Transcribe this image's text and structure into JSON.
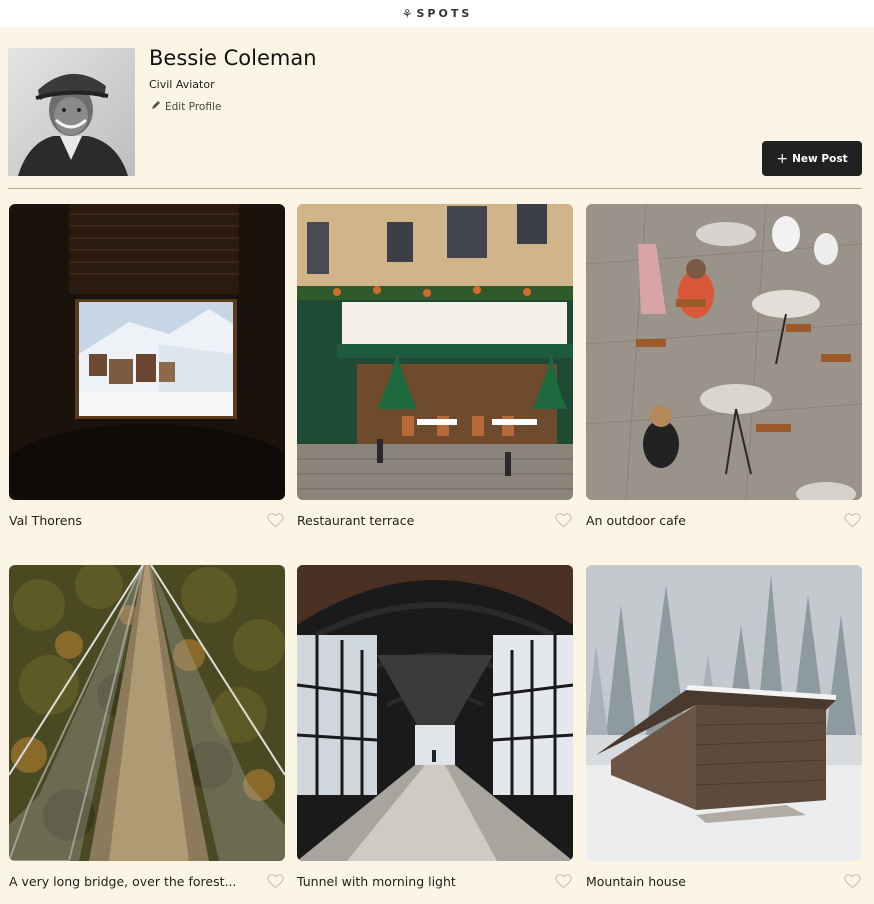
{
  "header": {
    "logo_text": "SPOTS",
    "logo_mark": "⚘"
  },
  "profile": {
    "name": "Bessie Coleman",
    "description": "Civil Aviator",
    "edit_label": "Edit Profile",
    "avatar_icon": "portrait-photo"
  },
  "actions": {
    "new_post_label": "New Post",
    "new_post_icon": "+"
  },
  "cards": [
    {
      "title": "Val Thorens",
      "image": "window-view-snowy-mountains"
    },
    {
      "title": "Restaurant terrace",
      "image": "parisian-restaurant-storefront"
    },
    {
      "title": "An outdoor cafe",
      "image": "cafe-tables-overhead"
    },
    {
      "title": "A very long bridge, over the forest...",
      "image": "suspension-bridge-forest"
    },
    {
      "title": "Tunnel with morning light",
      "image": "glass-covered-walkway"
    },
    {
      "title": "Mountain house",
      "image": "wooden-hut-snowy-forest"
    }
  ],
  "colors": {
    "background": "#fcf5e6",
    "button": "#212121",
    "divider": "#b9ab95"
  }
}
